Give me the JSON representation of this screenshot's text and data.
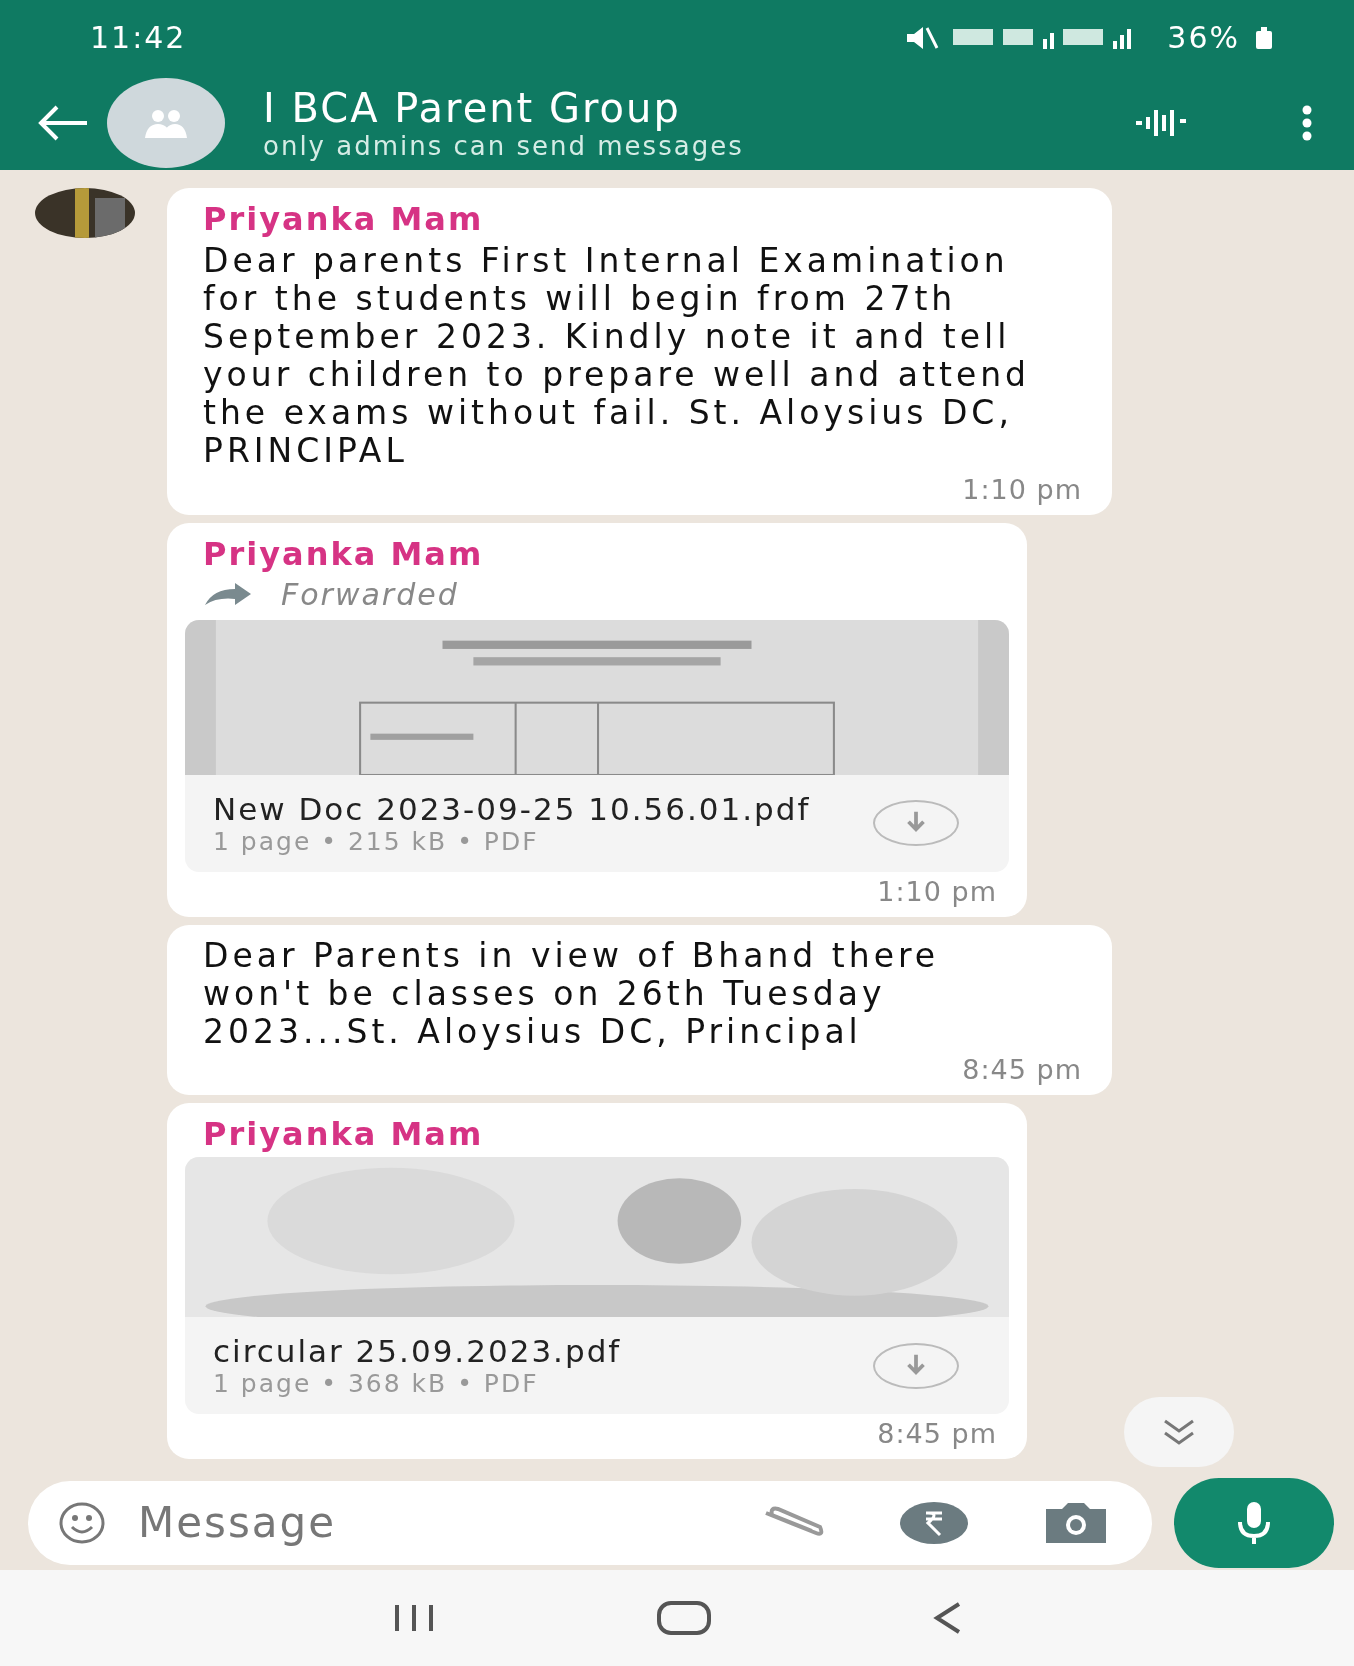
{
  "status_bar": {
    "time": "11:42",
    "battery": "36%"
  },
  "header": {
    "title": "I BCA Parent Group",
    "subtitle": "only admins can send messages"
  },
  "messages": [
    {
      "kind": "text",
      "sender": "Priyanka Mam",
      "text": "Dear parents First Internal Examination for the students will begin from 27th September 2023. Kindly note it and tell your children to prepare well and attend the exams without fail. St. Aloysius DC, PRINCIPAL",
      "time": "1:10 pm",
      "avatar": true
    },
    {
      "kind": "document",
      "sender": "Priyanka Mam",
      "forwarded": "Forwarded",
      "file_name": "New Doc 2023-09-25 10.56.01.pdf",
      "file_meta": "1 page • 215 kB • PDF",
      "time": "1:10 pm",
      "avatar": false
    },
    {
      "kind": "text",
      "text": "Dear Parents in view of Bhand there won't be classes on 26th Tuesday 2023...St. Aloysius DC, Principal",
      "time": "8:45 pm",
      "avatar": false
    },
    {
      "kind": "document",
      "sender": "Priyanka Mam",
      "file_name": "circular 25.09.2023.pdf",
      "file_meta": "1 page • 368 kB • PDF",
      "time": "8:45 pm",
      "avatar": false
    }
  ],
  "composer": {
    "placeholder": "Message"
  }
}
